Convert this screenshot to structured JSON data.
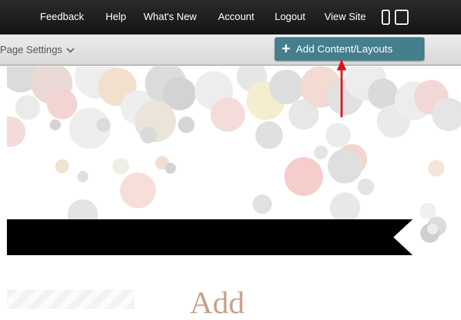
{
  "topbar": {
    "links": [
      "Feedback",
      "Help",
      "What's New",
      "Account",
      "Logout",
      "View Site"
    ],
    "device_icons": [
      "phone-icon",
      "tablet-icon"
    ]
  },
  "subbar": {
    "page_settings_label": "Page Settings",
    "add_button_label": "Add Content/Layouts"
  },
  "content": {
    "heading_partial": "Add"
  },
  "colors": {
    "topbar_bg": "#1e1e1e",
    "add_button_bg": "#457f8c",
    "arrow": "#e0101c",
    "heading": "#caa18a"
  }
}
